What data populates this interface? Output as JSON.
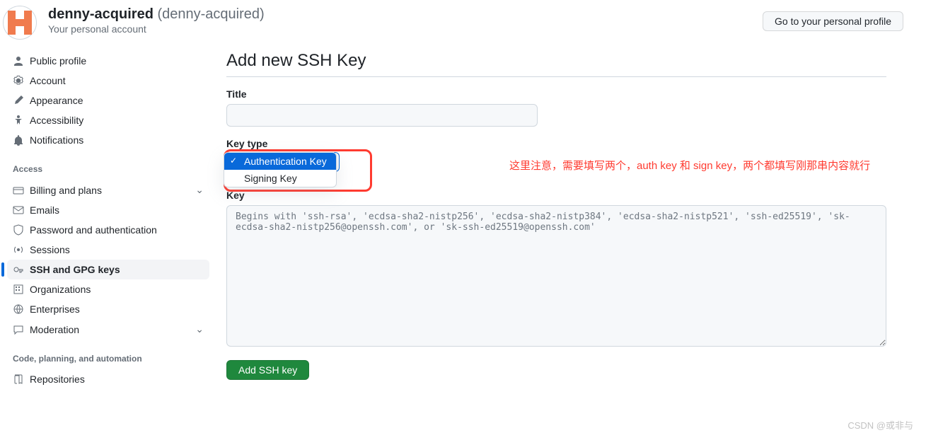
{
  "header": {
    "name": "denny-acquired",
    "handle": "(denny-acquired)",
    "subtitle": "Your personal account",
    "profile_btn": "Go to your personal profile"
  },
  "sidebar": {
    "items_top": [
      {
        "icon": "person",
        "label": "Public profile"
      },
      {
        "icon": "gear",
        "label": "Account"
      },
      {
        "icon": "brush",
        "label": "Appearance"
      },
      {
        "icon": "a11y",
        "label": "Accessibility"
      },
      {
        "icon": "bell",
        "label": "Notifications"
      }
    ],
    "access_title": "Access",
    "items_access": [
      {
        "icon": "card",
        "label": "Billing and plans",
        "chev": true
      },
      {
        "icon": "mail",
        "label": "Emails"
      },
      {
        "icon": "shield",
        "label": "Password and authentication"
      },
      {
        "icon": "broadcast",
        "label": "Sessions"
      },
      {
        "icon": "key",
        "label": "SSH and GPG keys",
        "active": true
      },
      {
        "icon": "org",
        "label": "Organizations"
      },
      {
        "icon": "globe",
        "label": "Enterprises"
      },
      {
        "icon": "comment",
        "label": "Moderation",
        "chev": true
      }
    ],
    "code_title": "Code, planning, and automation",
    "items_code": [
      {
        "icon": "repo",
        "label": "Repositories"
      }
    ]
  },
  "main": {
    "heading": "Add new SSH Key",
    "title_label": "Title",
    "title_value": "",
    "keytype_label": "Key type",
    "dropdown": {
      "options": [
        "Authentication Key",
        "Signing Key"
      ],
      "selected": "Authentication Key"
    },
    "annotation": "这里注意，需要填写两个，auth key 和 sign key，两个都填写刚那串内容就行",
    "key_label": "Key",
    "key_placeholder": "Begins with 'ssh-rsa', 'ecdsa-sha2-nistp256', 'ecdsa-sha2-nistp384', 'ecdsa-sha2-nistp521', 'ssh-ed25519', 'sk-ecdsa-sha2-nistp256@openssh.com', or 'sk-ssh-ed25519@openssh.com'",
    "key_value": "",
    "submit": "Add SSH key"
  },
  "watermark": "CSDN @或非与"
}
